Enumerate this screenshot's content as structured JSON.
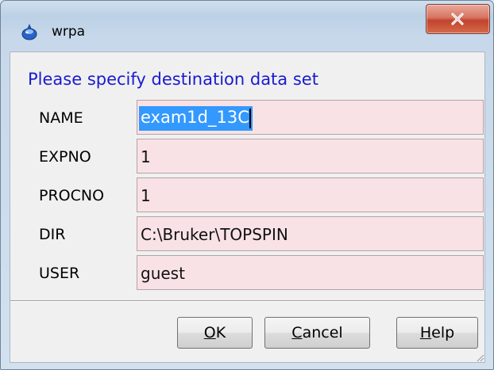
{
  "window": {
    "title": "wrpa",
    "icon": "topspin-app-icon",
    "close_icon": "close-x-icon"
  },
  "dialog": {
    "prompt": "Please specify destination data set",
    "fields": [
      {
        "label": "NAME",
        "value_before": "exam1d_13C",
        "value_after": "",
        "selected": true
      },
      {
        "label": "EXPNO",
        "value": "1"
      },
      {
        "label": "PROCNO",
        "value": "1"
      },
      {
        "label": "DIR",
        "value": "C:\\Bruker\\TOPSPIN"
      },
      {
        "label": "USER",
        "value": "guest"
      }
    ],
    "buttons": {
      "ok_mnemonic": "O",
      "ok_rest": "K",
      "cancel_mnemonic": "C",
      "cancel_rest": "ancel",
      "help_mnemonic": "H",
      "help_rest": "elp"
    }
  },
  "colors": {
    "prompt_text": "#1a1ad0",
    "field_background": "#f9e2e5",
    "selection": "#3399ff",
    "close_button": "#c2432d"
  }
}
